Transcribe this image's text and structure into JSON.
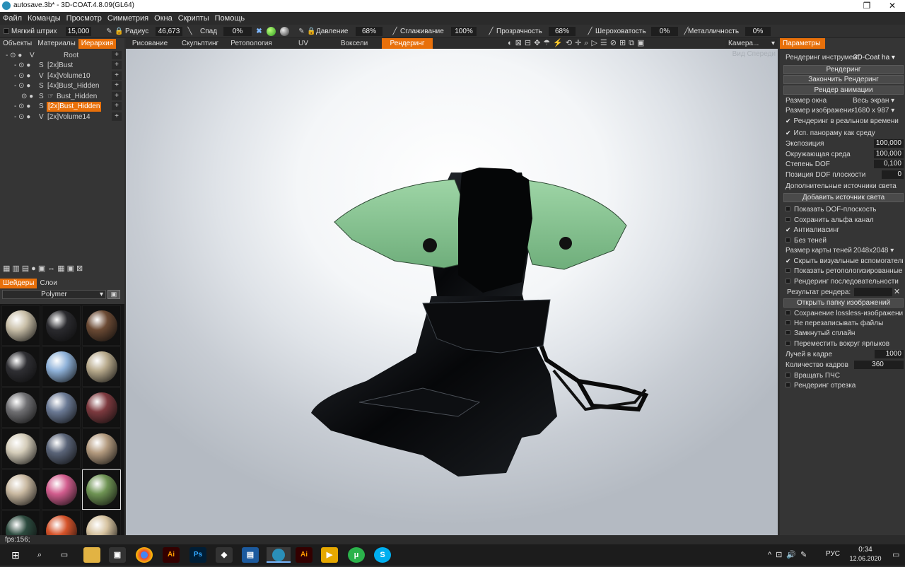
{
  "window": {
    "title": "autosave.3b* - 3D-COAT.4.8.09(GL64)",
    "minimize": "−",
    "maximize": "❐",
    "close": "✕"
  },
  "menu": [
    "Файл",
    "Команды",
    "Просмотр",
    "Симметрия",
    "Окна",
    "Скрипты",
    "Помощь"
  ],
  "toolbar": {
    "soft_stroke_label": "Мягкий штрих",
    "soft_stroke_value": "15,000",
    "radius_label": "Радиус",
    "radius_value": "46,673",
    "falloff_label": "Спад",
    "falloff_value": "0%",
    "pressure_label": "Давление",
    "pressure_value": "68%",
    "smoothing_label": "Сглаживание",
    "smoothing_value": "100%",
    "transparency_label": "Прозрачность",
    "transparency_value": "68%",
    "roughness_label": "Шероховатость",
    "roughness_value": "0%",
    "metalness_label": "Металличность",
    "metalness_value": "0%"
  },
  "left_panel": {
    "tabs": [
      "Объекты",
      "Материалы",
      "Иерархия"
    ],
    "active_tab": "Иерархия",
    "tree": [
      {
        "vis": "V",
        "name": "Root"
      },
      {
        "vis": "S",
        "name": "[2x]Bust"
      },
      {
        "vis": "V",
        "name": "[4x]Volume10"
      },
      {
        "vis": "S",
        "name": "[4x]Bust_Hidden"
      },
      {
        "vis": "S",
        "name": "Bust_Hidden"
      },
      {
        "vis": "S",
        "name": "[2x]Bust_Hidden"
      },
      {
        "vis": "V",
        "name": "[2x]Volume14"
      }
    ],
    "selected_row": 5,
    "shader_tabs": [
      "Шейдеры",
      "Слои"
    ],
    "active_shader_tab": "Шейдеры",
    "shader_filter": "Polymer",
    "swatches": [
      "#c9bfa8",
      "#2a2a2e",
      "#6b4a34",
      "#2f2f33",
      "#8fb2d9",
      "#b8aa8c",
      "#6f6f72",
      "#6b7a95",
      "#7d3a3f",
      "#d4ccb9",
      "#5a6478",
      "#b49b7f",
      "#c9b9a1",
      "#d25d8e",
      "#6f9454",
      "#2c4a3e",
      "#d5532a",
      "#d6c3a0"
    ]
  },
  "view_tabs": [
    "Рисование",
    "Скульптинг",
    "Ретопология",
    "UV",
    "Воксели",
    "Рендеринг"
  ],
  "active_view_tab": "Рендеринг",
  "camera": {
    "label": "Камера..."
  },
  "viewport": {
    "view_label": "Вид Спереди"
  },
  "right_panel": {
    "tab": "Параметры",
    "render_tool_label": "Рендеринг инструмент",
    "render_tool_value": "3D-Coat ha",
    "btn_render": "Рендеринг",
    "btn_finish": "Закончить Рендеринг",
    "btn_anim": "Рендер анимации",
    "window_size_label": "Размер окна",
    "window_size_value": "Весь экран",
    "image_size_label": "Размер изображения",
    "image_size_value": "1680 x 987",
    "realtime": "Рендеринг в реальном времени",
    "panorama": "Исп. панораму как среду",
    "exposure_label": "Экспозиция",
    "exposure_value": "100,000",
    "env_label": "Окружающая среда",
    "env_value": "100,000",
    "dof_label": "Степень DOF",
    "dof_value": "0,100",
    "dofpos_label": "Позиция DOF плоскости",
    "dofpos_value": "0",
    "extra_lights": "Дополнительные источники света",
    "btn_add_light": "Добавить источник света",
    "show_dof": "Показать DOF-плоскость",
    "save_alpha": "Сохранить альфа канал",
    "antialias": "Антиалиасинг",
    "no_shadows": "Без теней",
    "shadow_map_label": "Размер карты теней",
    "shadow_map_value": "2048x2048",
    "hide_helpers": "Скрыть визуальные вспомогательные",
    "show_retopo": "Показать ретопологизированные",
    "render_seq": "Рендеринг последовательности",
    "result_label": "Результат рендера:",
    "btn_open_folder": "Открыть папку изображений",
    "save_lossless": "Сохранение lossless-изображений",
    "no_overwrite": "Не перезаписывать файлы",
    "closed_spline": "Замкнутый сплайн",
    "move_around": "Переместить вокруг ярлыков",
    "rays_label": "Лучей в кадре",
    "rays_value": "1000",
    "frames_label": "Количество кадров",
    "frames_value": "360",
    "rotate_pcs": "Вращать ПЧС",
    "render_segment": "Рендеринг отрезка"
  },
  "status": {
    "fps": "fps:156;"
  },
  "taskbar": {
    "lang": "РУС",
    "time": "0:34",
    "date": "12.06.2020"
  }
}
